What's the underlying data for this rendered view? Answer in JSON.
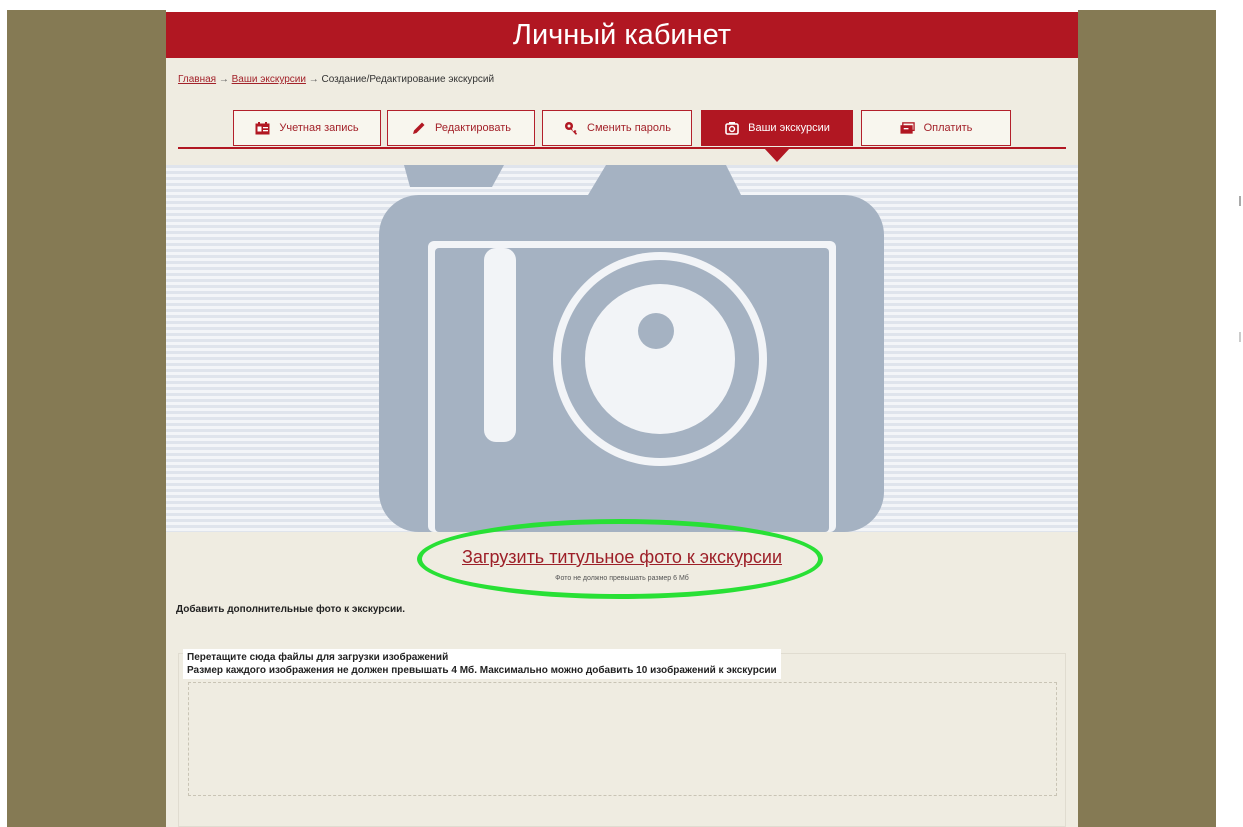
{
  "header": {
    "title": "Личный кабинет"
  },
  "breadcrumb": {
    "items": [
      "Главная",
      "Ваши экскурсии",
      "Создание/Редактирование экскурсий"
    ],
    "separator": "→"
  },
  "tabs": [
    {
      "label": "Учетная запись",
      "icon": "id-card-icon"
    },
    {
      "label": "Редактировать",
      "icon": "pencil-icon"
    },
    {
      "label": "Сменить пароль",
      "icon": "key-icon"
    },
    {
      "label": "Ваши экскурсии",
      "icon": "camera-icon",
      "active": true
    },
    {
      "label": "Оплатить",
      "icon": "wallet-icon"
    }
  ],
  "photo": {
    "placeholder_icon": "camera-icon"
  },
  "upload": {
    "link_label": "Загрузить титульное фото к экскурсии",
    "note": "Фото не должно превышать размер 6 Мб"
  },
  "gallery": {
    "heading": "Добавить дополнительные фото к экскурсии.",
    "drop_line1": "Перетащите сюда файлы для загрузки изображений",
    "drop_line2": "Размер каждого изображения не должен превышать 4 Мб. Максимально можно добавить 10 изображений к экскурсии"
  },
  "colors": {
    "brand_red": "#b11722",
    "side_olive": "#857a54",
    "page_bg": "#efece1",
    "highlight_green": "#28e035",
    "camera_gray": "#a5b2c2"
  }
}
